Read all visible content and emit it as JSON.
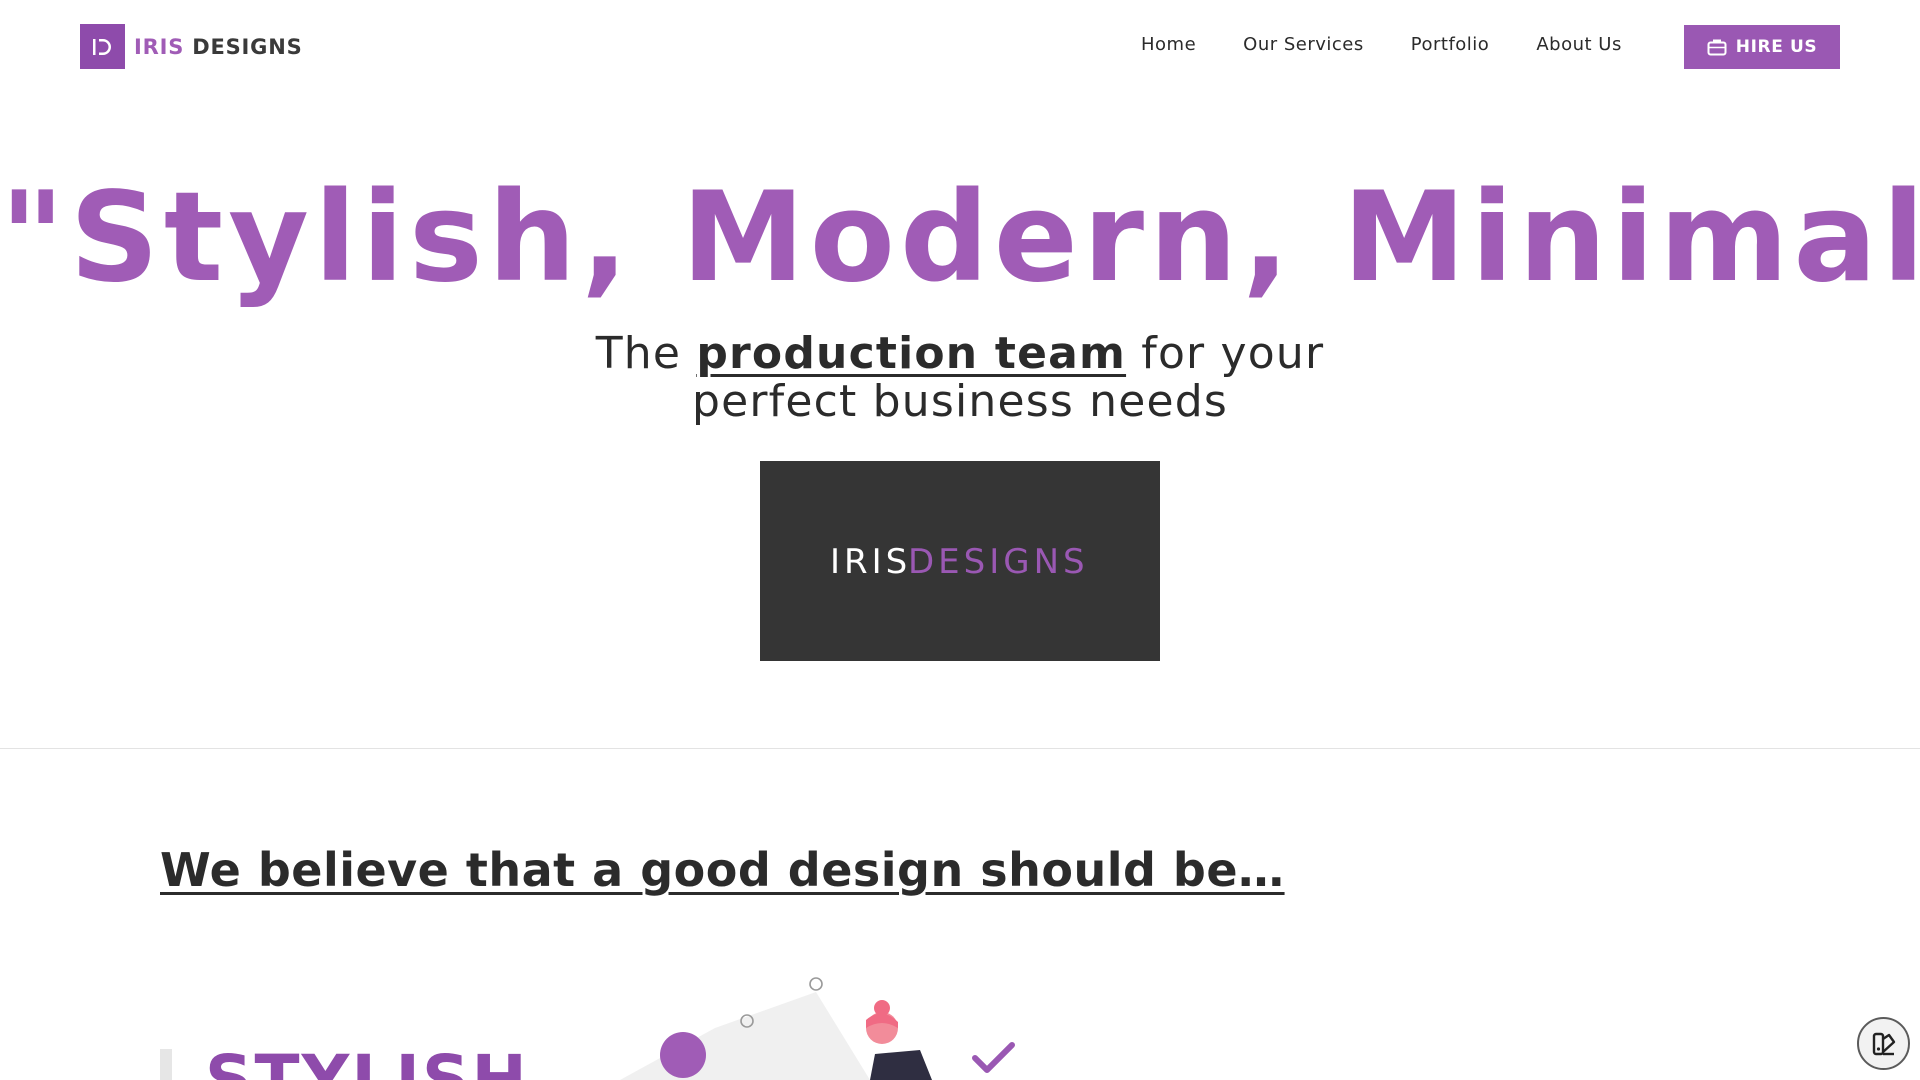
{
  "header": {
    "logo_part1": "IRIS",
    "logo_part2": "DESIGNS",
    "nav": [
      "Home",
      "Our Services",
      "Portfolio",
      "About Us"
    ],
    "hire_label": "HIRE US"
  },
  "hero": {
    "title": "\"Stylish, Modern, Minimal\"",
    "sub_prefix": "The ",
    "sub_emphasis": "production team",
    "sub_suffix": " for your perfect business needs"
  },
  "brand_image": {
    "text_light": "IRIS",
    "text_accent": "DESIGNS"
  },
  "section": {
    "heading": "We believe that a good design should be…",
    "first_item": "STYLISH"
  },
  "icons": {
    "logo": "logo-mark-icon",
    "hire": "briefcase-icon",
    "fab": "theme-toggle-icon",
    "illustration": "designer-illustration"
  },
  "colors": {
    "accent": "#a05cb6",
    "accent_dark": "#8e4bab",
    "button": "#9a58b3",
    "brand_box": "#353535",
    "text": "#2b2b2b"
  }
}
